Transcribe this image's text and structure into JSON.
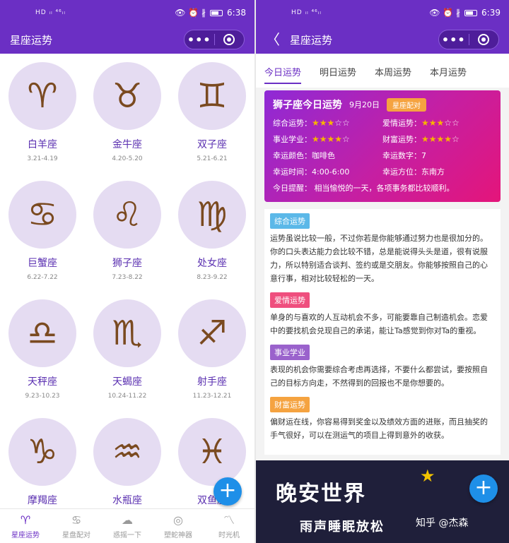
{
  "left": {
    "status": {
      "signal": "HD ᵢₗ ⁴⁶ᵢₗ",
      "icons": "👁 ⏰ ∦",
      "time": "6:38"
    },
    "nav": {
      "title": "星座运势",
      "more": "•••"
    },
    "zodiacs": [
      {
        "name": "白羊座",
        "dates": "3.21-4.19",
        "icon": "♈"
      },
      {
        "name": "金牛座",
        "dates": "4.20-5.20",
        "icon": "♉"
      },
      {
        "name": "双子座",
        "dates": "5.21-6.21",
        "icon": "♊"
      },
      {
        "name": "巨蟹座",
        "dates": "6.22-7.22",
        "icon": "♋"
      },
      {
        "name": "狮子座",
        "dates": "7.23-8.22",
        "icon": "♌"
      },
      {
        "name": "处女座",
        "dates": "8.23-9.22",
        "icon": "♍"
      },
      {
        "name": "天秤座",
        "dates": "9.23-10.23",
        "icon": "♎"
      },
      {
        "name": "天蝎座",
        "dates": "10.24-11.22",
        "icon": "♏"
      },
      {
        "name": "射手座",
        "dates": "11.23-12.21",
        "icon": "♐"
      },
      {
        "name": "摩羯座",
        "dates": "",
        "icon": "♑"
      },
      {
        "name": "水瓶座",
        "dates": "",
        "icon": "♒"
      },
      {
        "name": "双鱼座",
        "dates": "",
        "icon": "♓"
      }
    ],
    "fab": "+",
    "tabs": [
      {
        "label": "星座运势",
        "icon": "♈"
      },
      {
        "label": "星盘配对",
        "icon": "♋"
      },
      {
        "label": "惑摇一下",
        "icon": "☁"
      },
      {
        "label": "塑蛇神器",
        "icon": "◎"
      },
      {
        "label": "时光机",
        "icon": "〽"
      }
    ]
  },
  "right": {
    "status": {
      "signal": "HD ᵢₗ ⁴⁶ᵢₗ",
      "icons": "👁 ⏰ ∦",
      "time": "6:39"
    },
    "nav": {
      "back": "〈",
      "title": "星座运势",
      "more": "•••"
    },
    "period_tabs": [
      "今日运势",
      "明日运势",
      "本周运势",
      "本月运势"
    ],
    "card": {
      "title": "狮子座今日运势",
      "date": "9月20日",
      "match_button": "星座配对",
      "overall_label": "综合运势：",
      "overall_stars": 3,
      "love_label": "爱情运势：",
      "love_stars": 3,
      "career_label": "事业学业：",
      "career_stars": 4,
      "wealth_label": "财富运势：",
      "wealth_stars": 4,
      "color_label": "幸运颜色：",
      "color_value": "咖啡色",
      "number_label": "幸运数字：",
      "number_value": "7",
      "time_label": "幸运时间：",
      "time_value": "4:00-6:00",
      "direction_label": "幸运方位：",
      "direction_value": "东南方",
      "tip_label": "今日提醒：",
      "tip_value": "相当愉悦的一天，各项事务都比较顺利。"
    },
    "sections": [
      {
        "tag": "综合运势",
        "color": "#5bb8e8",
        "text": "运势虽说比较一般，不过你若是你能够通过努力也是很加分的。你的口头表达能力会比较不错，总是能说得头头是道，很有说服力，所以特别适合谈判、签约或是交朋友。你能够按照自己的心意行事，相对比较轻松的一天。"
      },
      {
        "tag": "爱情运势",
        "color": "#ef4f7e",
        "text": "单身的与喜欢的人互动机会不多，可能要靠自己制造机会。恋爱中的要找机会兑现自己的承诺，能让Ta感觉到你对Ta的重视。"
      },
      {
        "tag": "事业学业",
        "color": "#9a62cc",
        "text": "表现的机会你需要综合考虑再选择，不要什么都尝试，要按照自己的目标方向走，不然得到的回报也不是你想要的。"
      },
      {
        "tag": "财富运势",
        "color": "#f5a340",
        "text": "偏财运在线，你容易得到奖金以及绩效方面的进账，而且抽奖的手气很好，可以在测运气的项目上得到意外的收获。"
      }
    ],
    "banner": {
      "big": "晚安世界",
      "small": "雨声睡眠放松",
      "watermark": "知乎 @杰森"
    },
    "fab": "+"
  }
}
